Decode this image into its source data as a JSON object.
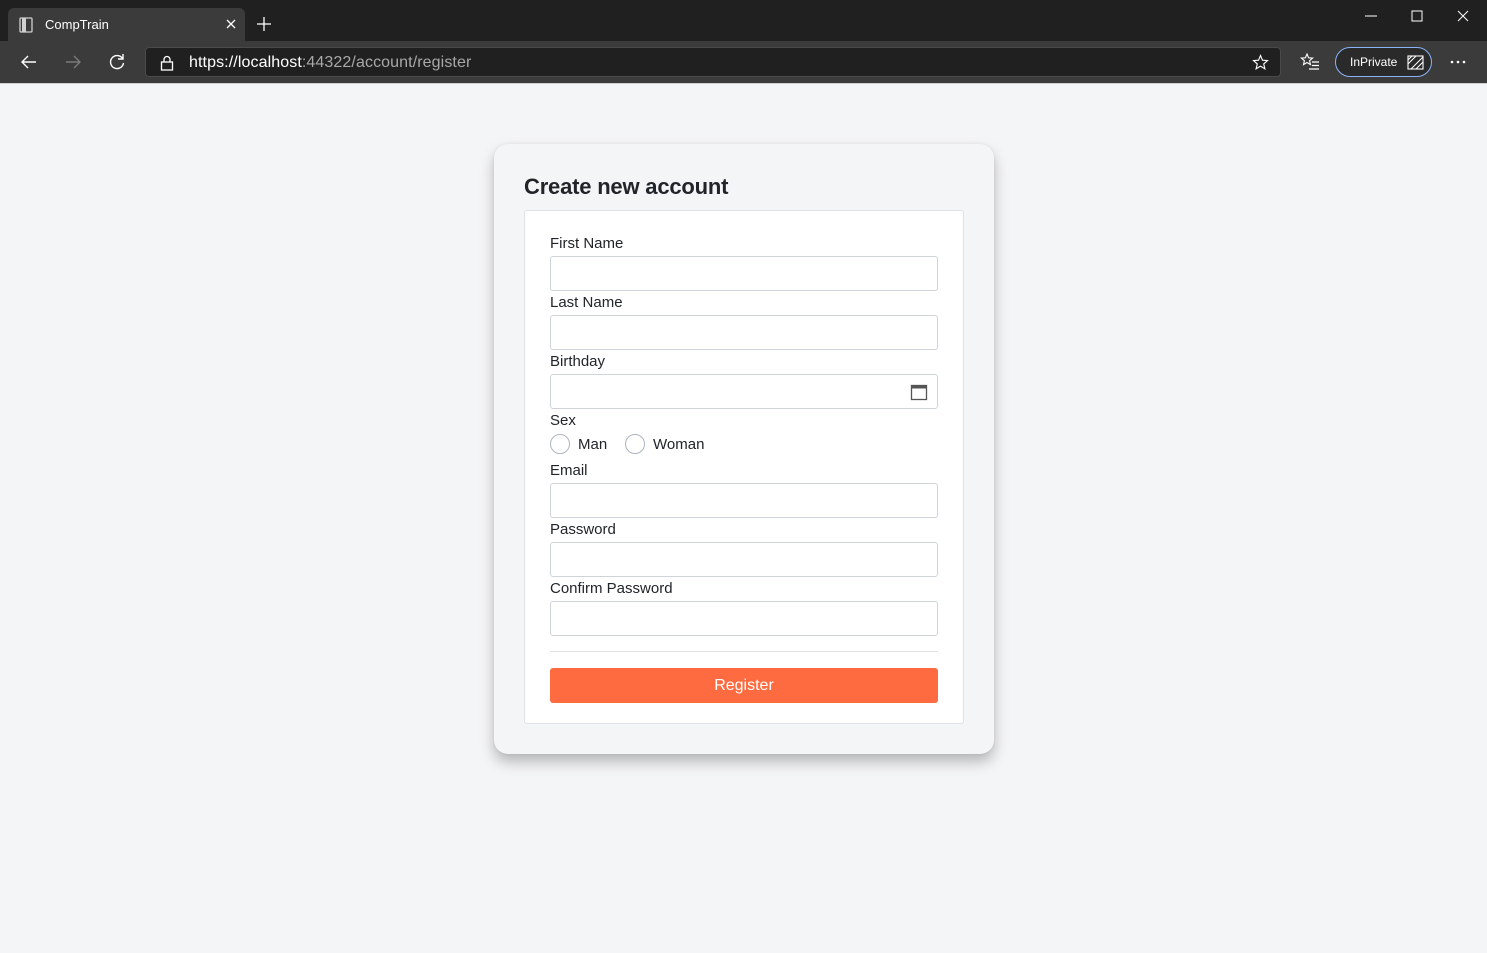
{
  "browser": {
    "tab_title": "CompTrain",
    "url": {
      "scheme": "https://",
      "host": "localhost",
      "rest": ":44322/account/register"
    },
    "inprivate_label": "InPrivate",
    "icons": [
      "page-icon",
      "close-icon",
      "plus-icon",
      "minimize-icon",
      "maximize-icon",
      "close-window-icon",
      "back-arrow-icon",
      "forward-arrow-icon",
      "refresh-icon",
      "lock-icon",
      "star-icon",
      "favorites-icon",
      "inprivate-icon",
      "more-icon"
    ]
  },
  "page": {
    "title": "Create new account",
    "form": {
      "first_name_label": "First Name",
      "last_name_label": "Last Name",
      "birthday_label": "Birthday",
      "sex_label": "Sex",
      "sex_options": [
        "Man",
        "Woman"
      ],
      "email_label": "Email",
      "password_label": "Password",
      "confirm_password_label": "Confirm Password",
      "register_label": "Register"
    }
  },
  "colors": {
    "accent": "#ff6b40",
    "page_bg": "#f4f5f7"
  }
}
